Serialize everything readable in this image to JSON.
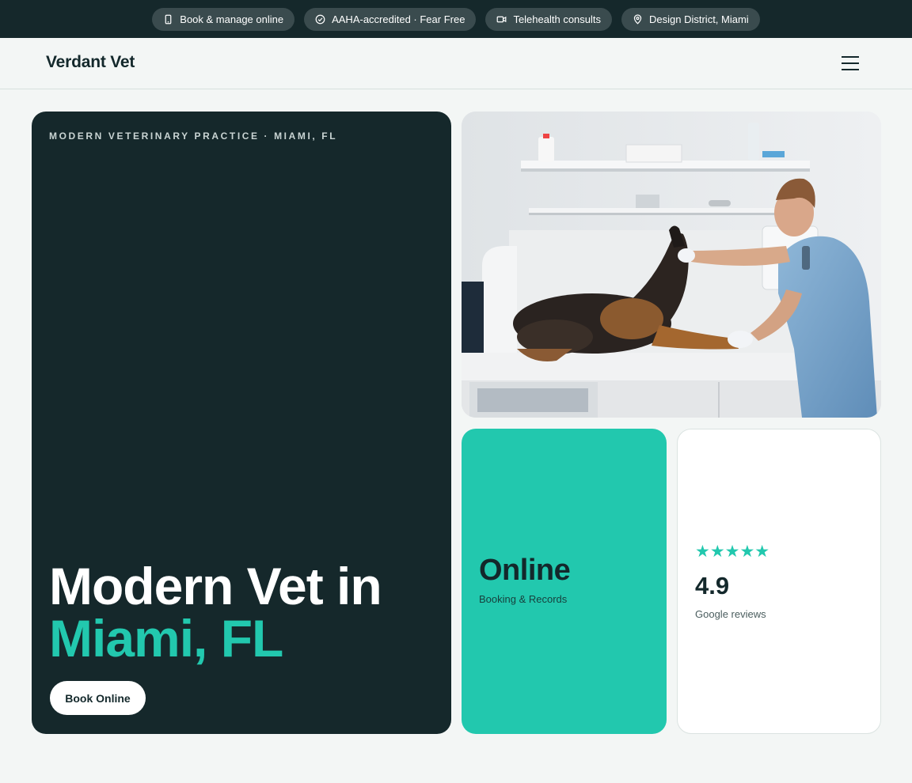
{
  "topbar": {
    "pills": [
      {
        "icon": "phone-icon",
        "label": "Book & manage online"
      },
      {
        "icon": "check-circle-icon",
        "label": "AAHA-accredited · Fear Free"
      },
      {
        "icon": "video-camera-icon",
        "label": "Telehealth consults"
      },
      {
        "icon": "map-pin-icon",
        "label": "Design District, Miami"
      }
    ]
  },
  "header": {
    "brand": "Verdant Vet",
    "menu_icon": "hamburger-menu-icon"
  },
  "hero": {
    "eyebrow": "MODERN VETERINARY PRACTICE · MIAMI, FL",
    "title_line1": "Modern Vet in",
    "title_line2": "Miami, FL",
    "cta_label": "Book Online"
  },
  "stats": {
    "online": {
      "value": "Online",
      "label": "Booking & Records"
    },
    "reviews": {
      "stars": "★★★★★",
      "star_count": 5,
      "value": "4.9",
      "label": "Google reviews"
    }
  },
  "colors": {
    "dark": "#15282b",
    "accent": "#22c8ae",
    "page_bg": "#f3f6f5"
  }
}
